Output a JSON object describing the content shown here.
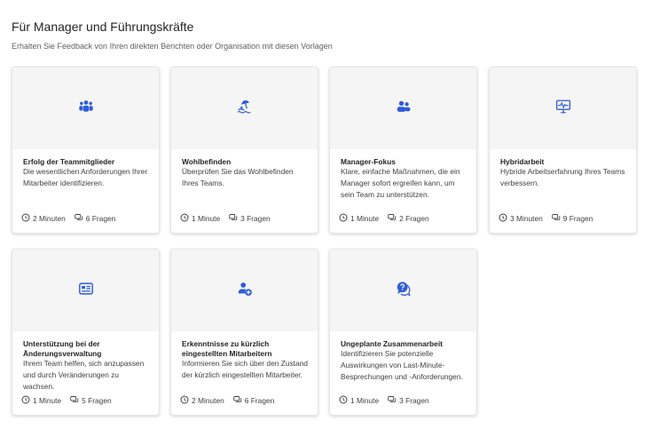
{
  "section": {
    "title": "Für Manager und Führungskräfte",
    "subtitle": "Erhalten Sie Feedback von Ihren direkten Berichten oder Organisation mit diesen Vorlagen"
  },
  "accent_color": "#2f5dd8",
  "cards": [
    {
      "icon": "team-icon",
      "title": "Erfolg der Teammitglieder",
      "description": "Die wesentlichen Anforderungen Ihrer Mitarbeiter identifizieren.",
      "duration": "2 Minuten",
      "questions": "6 Fragen"
    },
    {
      "icon": "wellbeing-icon",
      "title": "Wohlbefinden",
      "description": "Überprüfen Sie das Wohlbefinden Ihres Teams.",
      "duration": "1 Minute",
      "questions": "3 Fragen"
    },
    {
      "icon": "people-icon",
      "title": "Manager-Fokus",
      "description": "Klare, einfache Maßnahmen, die ein Manager sofort ergreifen kann, um sein Team zu unterstützen.",
      "duration": "1 Minute",
      "questions": "2 Fragen"
    },
    {
      "icon": "monitor-pulse-icon",
      "title": "Hybridarbeit",
      "description": "Hybride Arbeitserfahrung Ihres Teams verbessern.",
      "duration": "3 Minuten",
      "questions": "9 Fragen"
    },
    {
      "icon": "news-icon",
      "title": "Unterstützung bei der Änderungsverwaltung",
      "description": "Ihrem Team helfen, sich anzupassen und durch Veränderungen zu wachsen.",
      "duration": "1 Minute",
      "questions": "5 Fragen"
    },
    {
      "icon": "person-add-icon",
      "title": "Erkenntnisse zu kürzlich eingestellten Mitarbeitern",
      "description": "Informieren Sie sich über den Zustand der kürzlich eingestellten Mitarbeiter.",
      "duration": "2 Minuten",
      "questions": "6 Fragen"
    },
    {
      "icon": "chat-help-icon",
      "title": "Ungeplante Zusammenarbeit",
      "description": "Identifizieren Sie potenzielle Auswirkungen von Last-Minute-Besprechungen und -Anforderungen.",
      "duration": "1 Minute",
      "questions": "3 Fragen"
    }
  ]
}
